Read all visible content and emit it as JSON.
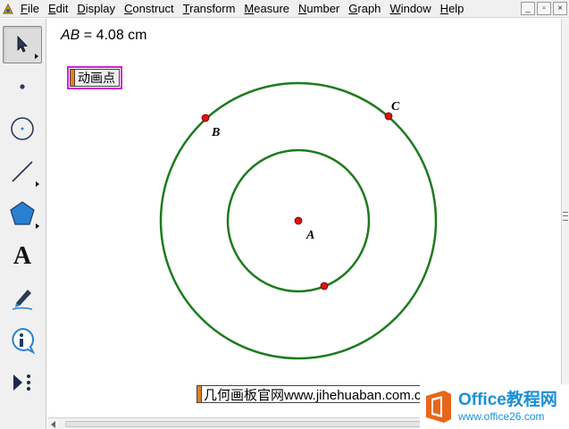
{
  "menubar": {
    "items": [
      {
        "label": "File",
        "mnemonic": "F",
        "rest": "ile"
      },
      {
        "label": "Edit",
        "mnemonic": "E",
        "rest": "dit"
      },
      {
        "label": "Display",
        "mnemonic": "D",
        "rest": "isplay"
      },
      {
        "label": "Construct",
        "mnemonic": "C",
        "rest": "onstruct"
      },
      {
        "label": "Transform",
        "mnemonic": "T",
        "rest": "ransform"
      },
      {
        "label": "Measure",
        "mnemonic": "M",
        "rest": "easure"
      },
      {
        "label": "Number",
        "mnemonic": "N",
        "rest": "umber"
      },
      {
        "label": "Graph",
        "mnemonic": "G",
        "rest": "raph"
      },
      {
        "label": "Window",
        "mnemonic": "W",
        "rest": "indow"
      },
      {
        "label": "Help",
        "mnemonic": "H",
        "rest": "elp"
      }
    ],
    "window_controls": {
      "minimize": "_",
      "restore": "▫",
      "close": "×"
    }
  },
  "toolbox": {
    "tools": [
      {
        "name": "arrow-tool",
        "icon": "arrow-icon",
        "selected": true
      },
      {
        "name": "point-tool",
        "icon": "point-icon"
      },
      {
        "name": "compass-tool",
        "icon": "compass-icon"
      },
      {
        "name": "straightedge-tool",
        "icon": "segment-icon"
      },
      {
        "name": "polygon-tool",
        "icon": "polygon-icon"
      },
      {
        "name": "text-tool",
        "icon": "text-icon",
        "glyph": "A"
      },
      {
        "name": "marker-tool",
        "icon": "marker-icon"
      },
      {
        "name": "information-tool",
        "icon": "info-icon",
        "glyph": "i"
      },
      {
        "name": "custom-tool",
        "icon": "custom-tool-icon"
      }
    ]
  },
  "canvas": {
    "measurement": {
      "segment": "AB",
      "equals": " = ",
      "value": "4.08 cm"
    },
    "animate_button": {
      "label": "动画点"
    },
    "points": {
      "A": "A",
      "B": "B",
      "C": "C"
    },
    "colors": {
      "circle": "#1e7a1e",
      "point": "#e01010",
      "handle": "#e07f2c",
      "button_border": "#d020d0"
    },
    "caption": {
      "label": "几何画板官网www.jihehuaban.com.cn"
    }
  },
  "watermark": {
    "brand_en": "Office",
    "brand_cn": "教程网",
    "url": "www.office26.com",
    "colors": {
      "brand": "#1a8fd8",
      "logo": "#e8661a"
    }
  }
}
